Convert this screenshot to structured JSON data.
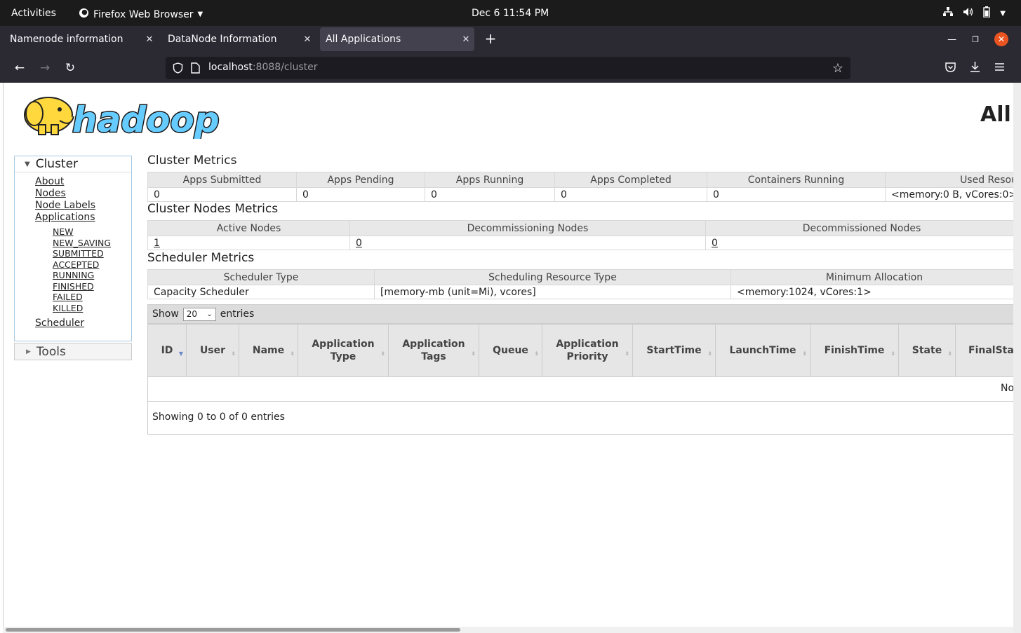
{
  "os": {
    "activities": "Activities",
    "app_name": "Firefox Web Browser",
    "clock": "Dec 6  11:54 PM"
  },
  "tabs": [
    {
      "label": "Namenode information",
      "close": "✕"
    },
    {
      "label": "DataNode Information",
      "close": "✕"
    },
    {
      "label": "All Applications",
      "close": "✕"
    }
  ],
  "browser": {
    "new_tab": "+",
    "url_host": "localhost",
    "url_path": ":8088/cluster"
  },
  "page": {
    "heading": "All"
  },
  "sidebar": {
    "cluster_header": "Cluster",
    "items": [
      "About",
      "Nodes",
      "Node Labels",
      "Applications"
    ],
    "app_states": [
      "NEW",
      "NEW_SAVING",
      "SUBMITTED",
      "ACCEPTED",
      "RUNNING",
      "FINISHED",
      "FAILED",
      "KILLED"
    ],
    "scheduler": "Scheduler",
    "tools_header": "Tools"
  },
  "cluster_metrics": {
    "title": "Cluster Metrics",
    "headers": [
      "Apps Submitted",
      "Apps Pending",
      "Apps Running",
      "Apps Completed",
      "Containers Running",
      "Used Resou"
    ],
    "values": [
      "0",
      "0",
      "0",
      "0",
      "0",
      "<memory:0 B, vCores:0>"
    ]
  },
  "nodes_metrics": {
    "title": "Cluster Nodes Metrics",
    "headers": [
      "Active Nodes",
      "Decommissioning Nodes",
      "Decommissioned Nodes"
    ],
    "values": [
      "1",
      "0",
      "0"
    ]
  },
  "scheduler_metrics": {
    "title": "Scheduler Metrics",
    "headers": [
      "Scheduler Type",
      "Scheduling Resource Type",
      "Minimum Allocation"
    ],
    "values": [
      "Capacity Scheduler",
      "[memory-mb (unit=Mi), vcores]",
      "<memory:1024, vCores:1>"
    ]
  },
  "apps_table": {
    "show_label": "Show",
    "page_size": "20",
    "entries_label": "entries",
    "columns": [
      "ID",
      "User",
      "Name",
      "Application Type",
      "Application Tags",
      "Queue",
      "Application Priority",
      "StartTime",
      "LaunchTime",
      "FinishTime",
      "State",
      "FinalSta"
    ],
    "empty_text": "No",
    "footer": "Showing 0 to 0 of 0 entries"
  },
  "colors": {
    "topbar": "#1b1b1b",
    "toolbar": "#2b2a33",
    "active_tab": "#42414d",
    "close_button": "#e95420",
    "logo_yellow": "#ffd83d",
    "logo_blue": "#66ccff"
  }
}
